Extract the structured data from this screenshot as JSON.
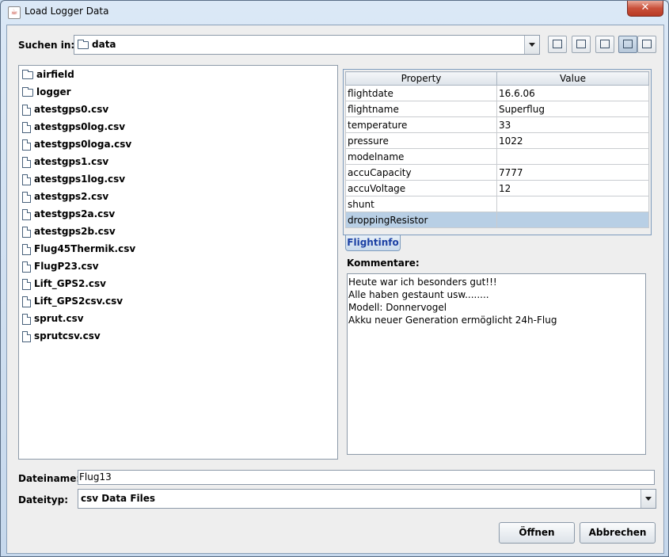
{
  "window": {
    "title": "Load Logger Data",
    "close_label": "✕"
  },
  "lookin": {
    "label": "Suchen in:",
    "value": "data"
  },
  "toolbar": {
    "icons": [
      "up-folder-icon",
      "home-icon",
      "new-folder-icon",
      "list-view-icon",
      "details-view-icon"
    ]
  },
  "files": [
    {
      "name": "airfield",
      "type": "folder"
    },
    {
      "name": "logger",
      "type": "folder"
    },
    {
      "name": "atestgps0.csv",
      "type": "file"
    },
    {
      "name": "atestgps0log.csv",
      "type": "file"
    },
    {
      "name": "atestgps0loga.csv",
      "type": "file"
    },
    {
      "name": "atestgps1.csv",
      "type": "file"
    },
    {
      "name": "atestgps1log.csv",
      "type": "file"
    },
    {
      "name": "atestgps2.csv",
      "type": "file"
    },
    {
      "name": "atestgps2a.csv",
      "type": "file"
    },
    {
      "name": "atestgps2b.csv",
      "type": "file"
    },
    {
      "name": "Flug45Thermik.csv",
      "type": "file"
    },
    {
      "name": "FlugP23.csv",
      "type": "file"
    },
    {
      "name": "Lift_GPS2.csv",
      "type": "file"
    },
    {
      "name": "Lift_GPS2csv.csv",
      "type": "file"
    },
    {
      "name": "sprut.csv",
      "type": "file"
    },
    {
      "name": "sprutcsv.csv",
      "type": "file"
    }
  ],
  "properties": {
    "header_property": "Property",
    "header_value": "Value",
    "rows": [
      {
        "property": "flightdate",
        "value": "16.6.06"
      },
      {
        "property": "flightname",
        "value": "Superflug"
      },
      {
        "property": "temperature",
        "value": "33"
      },
      {
        "property": "pressure",
        "value": "1022"
      },
      {
        "property": "modelname",
        "value": ""
      },
      {
        "property": "accuCapacity",
        "value": "7777"
      },
      {
        "property": "accuVoltage",
        "value": "12"
      },
      {
        "property": "shunt",
        "value": ""
      },
      {
        "property": "droppingResistor",
        "value": ""
      }
    ]
  },
  "tab": {
    "label": "Flightinfo"
  },
  "comments": {
    "label": "Kommentare:",
    "lines": [
      "Heute war ich besonders gut!!!",
      "Alle haben gestaunt usw........",
      "Modell: Donnervogel",
      "Akku neuer Generation ermöglicht 24h-Flug"
    ]
  },
  "filename": {
    "label": "Dateiname:",
    "value": "Flug13"
  },
  "filetype": {
    "label": "Dateityp:",
    "value": "csv Data Files"
  },
  "buttons": {
    "open": "Öffnen",
    "cancel": "Abbrechen"
  }
}
